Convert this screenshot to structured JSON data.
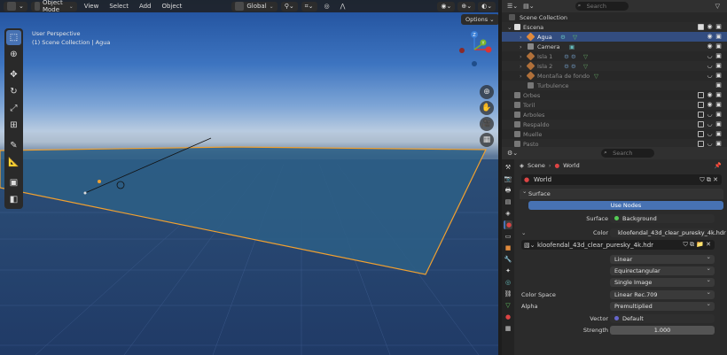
{
  "viewport": {
    "mode": "Object Mode",
    "menu": [
      "View",
      "Select",
      "Add",
      "Object"
    ],
    "transform_orientation": "Global",
    "options_label": "Options",
    "perspective_label": "User Perspective",
    "collection_label": "(1) Scene Collection | Agua"
  },
  "gizmo": {
    "z": "Z",
    "y": "Y",
    "x": "X"
  },
  "outliner": {
    "search_placeholder": "Search",
    "rows": [
      {
        "label": "Scene Collection"
      },
      {
        "label": "Escena"
      },
      {
        "label": "Agua"
      },
      {
        "label": "Camera"
      },
      {
        "label": "Isla 1"
      },
      {
        "label": "Isla 2"
      },
      {
        "label": "Montaña de fondo"
      },
      {
        "label": "Turbulence"
      },
      {
        "label": "Orbes"
      },
      {
        "label": "Toril"
      },
      {
        "label": "Arboles"
      },
      {
        "label": "Respaldo"
      },
      {
        "label": "Muelle"
      },
      {
        "label": "Pasto"
      }
    ]
  },
  "properties": {
    "search_placeholder": "Search",
    "breadcrumb": {
      "scene": "Scene",
      "world": "World"
    },
    "world_name": "World",
    "surface_section": "Surface",
    "use_nodes": "Use Nodes",
    "surface_label": "Surface",
    "surface_value": "Background",
    "color_label": "Color",
    "color_value": "kloofendal_43d_clear_puresky_4k.hdr",
    "image_name": "kloofendal_43d_clear_puresky_4k.hdr",
    "interpolation": "Linear",
    "projection": "Equirectangular",
    "source": "Single Image",
    "color_space_label": "Color Space",
    "color_space": "Linear Rec.709",
    "alpha_label": "Alpha",
    "alpha": "Premultiplied",
    "vector_label": "Vector",
    "vector": "Default",
    "strength_label": "Strength",
    "strength": "1.000"
  },
  "colors": {
    "accent": "#4772b3",
    "selection_outline": "#f0a030",
    "panel_bg": "#2b2b2b"
  }
}
